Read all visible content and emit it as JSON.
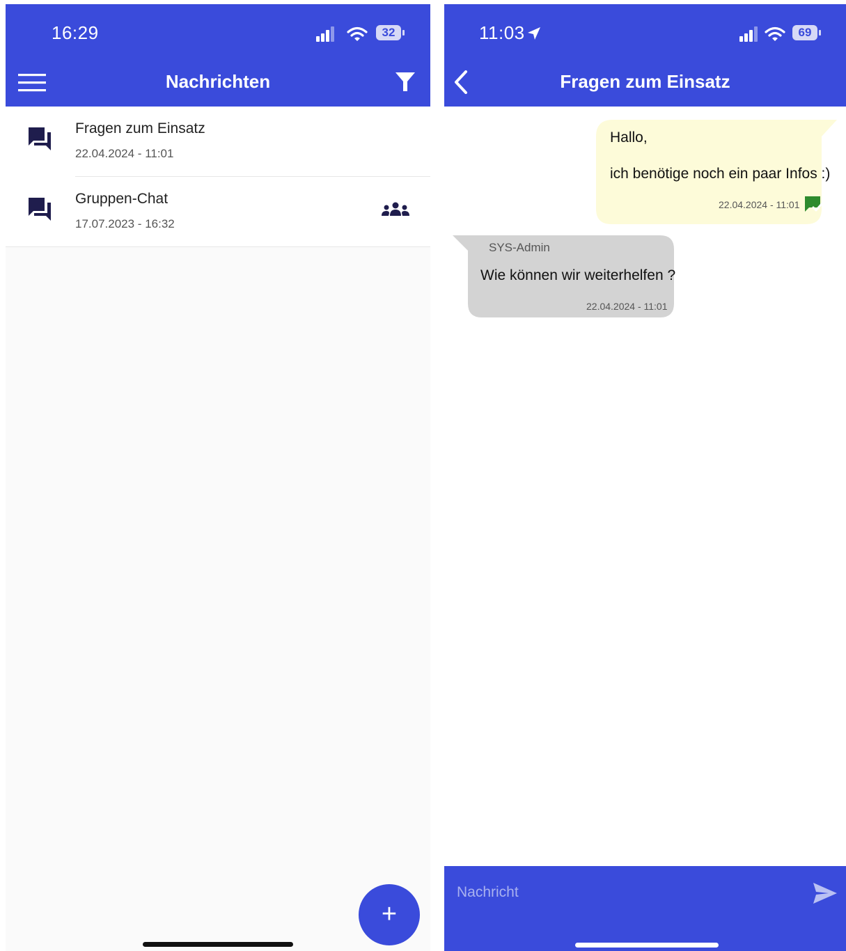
{
  "left": {
    "status": {
      "time": "16:29",
      "battery": "32"
    },
    "appbar": {
      "title": "Nachrichten",
      "menu_icon": "hamburger-menu-icon",
      "filter_icon": "filter-icon"
    },
    "conversations": [
      {
        "title": "Fragen zum Einsatz",
        "date": "22.04.2024 - 11:01",
        "icon": "chat-bubbles-icon"
      },
      {
        "title": "Gruppen-Chat",
        "date": "17.07.2023 - 16:32",
        "icon": "chat-bubbles-icon",
        "badge_icon": "group-icon"
      }
    ],
    "fab": {
      "label": "+",
      "icon": "plus-icon"
    }
  },
  "right": {
    "status": {
      "time": "11:03",
      "battery": "69"
    },
    "appbar": {
      "title": "Fragen zum Einsatz",
      "back_icon": "chevron-left-icon"
    },
    "messages": [
      {
        "direction": "outgoing",
        "lines": [
          "Hallo,",
          "ich benötige noch ein paar Infos :)"
        ],
        "time": "22.04.2024 - 11:01",
        "status_icon": "message-read-icon"
      },
      {
        "direction": "incoming",
        "sender": "SYS-Admin",
        "text": "Wie können wir weiterhelfen ?",
        "time": "22.04.2024 - 11:01"
      }
    ],
    "composer": {
      "placeholder": "Nachricht",
      "send_icon": "send-icon"
    }
  },
  "colors": {
    "accent": "#3a4bdb",
    "outgoing_bubble": "#fdfbd9",
    "incoming_bubble": "#d3d3d3",
    "read_status": "#2e8b2e",
    "icon_dark": "#1f1d4d"
  }
}
